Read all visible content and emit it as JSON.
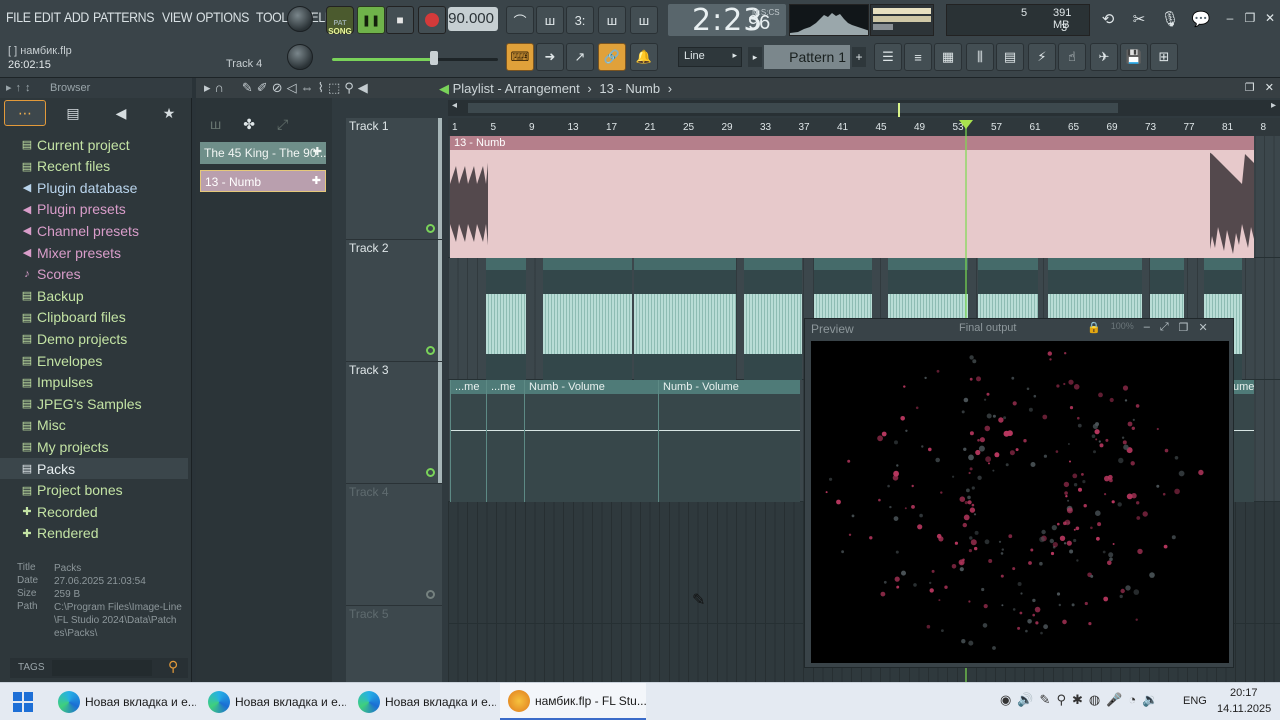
{
  "menu": [
    "FILE",
    "EDIT",
    "ADD",
    "PATTERNS",
    "VIEW",
    "OPTIONS",
    "TOOLS",
    "HELP"
  ],
  "project": {
    "name": "[  ] намбик.flp",
    "time": "26:02:15",
    "track_label": "Track 4"
  },
  "transport": {
    "mode_top": "PAT",
    "mode_bottom": "SONG",
    "tempo": "90.000",
    "clock_main": "2:23",
    "clock_frac": "96",
    "clock_format": "M:S:CS"
  },
  "meters": {
    "cpu_cores": "5",
    "memory": "391 MB",
    "voices": "3"
  },
  "snap": {
    "value": "Line"
  },
  "pattern": {
    "name": "Pattern 1"
  },
  "browser": {
    "title": "Browser",
    "items": [
      {
        "label": "Current project",
        "style": "green"
      },
      {
        "label": "Recent files",
        "style": "green"
      },
      {
        "label": "Plugin database",
        "style": "blue"
      },
      {
        "label": "Plugin presets",
        "style": "pink"
      },
      {
        "label": "Channel presets",
        "style": "pink"
      },
      {
        "label": "Mixer presets",
        "style": "pink"
      },
      {
        "label": "Scores",
        "style": "pink"
      },
      {
        "label": "Backup",
        "style": "green"
      },
      {
        "label": "Clipboard files",
        "style": "green"
      },
      {
        "label": "Demo projects",
        "style": "green"
      },
      {
        "label": "Envelopes",
        "style": "green"
      },
      {
        "label": "Impulses",
        "style": "green"
      },
      {
        "label": "JPEG's Samples",
        "style": "green"
      },
      {
        "label": "Misc",
        "style": "green"
      },
      {
        "label": "My projects",
        "style": "green"
      },
      {
        "label": "Packs",
        "style": "active"
      },
      {
        "label": "Project bones",
        "style": "green"
      },
      {
        "label": "Recorded",
        "style": "green"
      },
      {
        "label": "Rendered",
        "style": "green"
      }
    ],
    "info": {
      "title_k": "Title",
      "title_v": "Packs",
      "date_k": "Date",
      "date_v": "27.06.2025 21:03:54",
      "size_k": "Size",
      "size_v": "259 B",
      "path_k": "Path",
      "path_v": "C:\\Program Files\\Image-Line\\FL Studio 2024\\Data\\Patches\\Packs\\"
    },
    "tags_label": "TAGS"
  },
  "playlist": {
    "title": "Playlist - Arrangement",
    "breadcrumb_sep": "›",
    "current_clip": "13 - Numb",
    "clips": [
      "The 45 King - The 90...",
      "13 - Numb"
    ],
    "tracks": [
      "Track 1",
      "Track 2",
      "Track 3",
      "Track 4",
      "Track 5"
    ],
    "ruler": [
      "1",
      "5",
      "9",
      "13",
      "17",
      "21",
      "25",
      "29",
      "33",
      "37",
      "41",
      "45",
      "49",
      "53",
      "57",
      "61",
      "65",
      "69",
      "73",
      "77",
      "81",
      "8"
    ],
    "lane1_clip": "13 - Numb",
    "lane3_clips": [
      "...me",
      "...me",
      "Numb - Volume",
      "Numb - Volume",
      "ume"
    ]
  },
  "preview": {
    "title": "Preview",
    "output": "Final output",
    "zoom": "100%"
  },
  "taskbar": {
    "tasks": [
      "Новая вкладка и е...",
      "Новая вкладка и е...",
      "Новая вкладка и е...",
      "намбик.flp - FL Stu..."
    ],
    "lang": "ENG",
    "time": "20:17",
    "date": "14.11.2025"
  },
  "colors": {
    "accent_green": "#7ad35a",
    "accent_orange": "#e0a13a",
    "clip_pink": "#e5c4c7",
    "clip_teal": "#9dc6bf"
  }
}
